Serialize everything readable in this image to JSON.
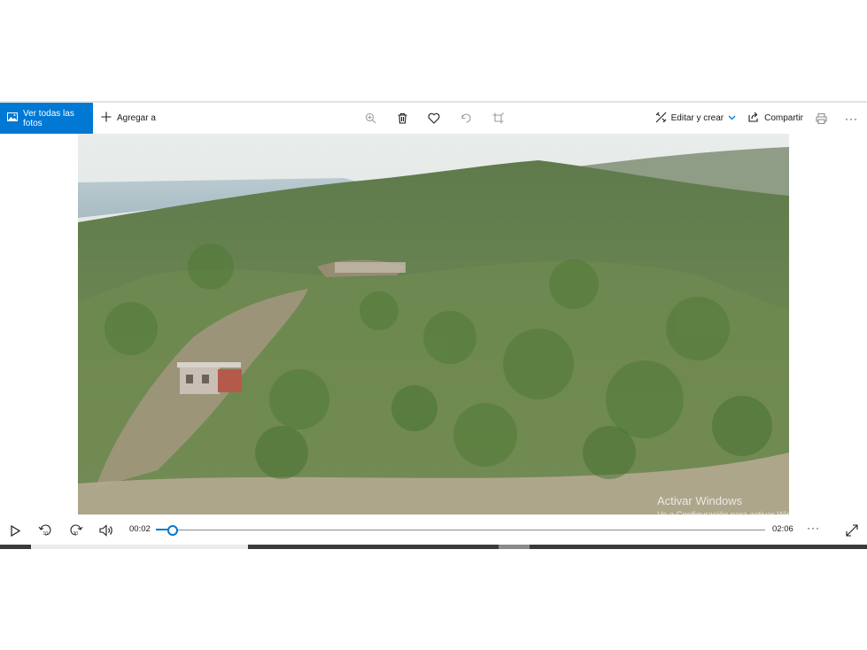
{
  "toolbar": {
    "view_all_label": "Ver todas las fotos",
    "add_to_label": "Agregar a",
    "edit_create_label": "Editar y crear",
    "share_label": "Compartir",
    "more_label": "···"
  },
  "player": {
    "current_time": "00:02",
    "total_time": "02:06",
    "progress_fraction": 0.028,
    "more_label": "···"
  },
  "watermark": {
    "title": "Activar Windows",
    "subtitle": "Ve a Configuración para activar Windows."
  },
  "colors": {
    "accent": "#0078d4",
    "toolbar_bg": "#ffffff",
    "taskbar": "#3a3a3a"
  },
  "icons": {
    "photos": "photos-icon",
    "add": "plus-icon",
    "zoom": "zoom-icon",
    "delete": "trash-icon",
    "favorite": "heart-icon",
    "rotate": "rotate-icon",
    "crop": "crop-icon",
    "edit": "edit-create-icon",
    "share": "share-icon",
    "print": "printer-icon",
    "play": "play-icon",
    "back10": "rewind-10-icon",
    "fwd30": "forward-30-icon",
    "volume": "volume-icon",
    "fullscreen": "expand-icon"
  }
}
